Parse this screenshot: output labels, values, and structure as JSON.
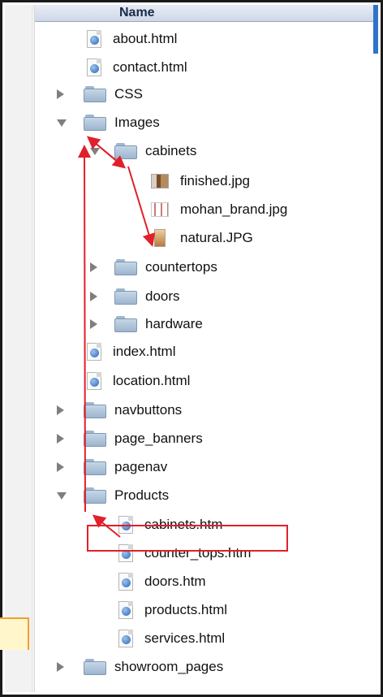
{
  "header": {
    "name_label": "Name"
  },
  "rows": [
    {
      "label": "about.html",
      "kind": "doc"
    },
    {
      "label": "contact.html",
      "kind": "doc"
    },
    {
      "label": "CSS",
      "kind": "folder",
      "state": "closed"
    },
    {
      "label": "Images",
      "kind": "folder",
      "state": "open"
    },
    {
      "label": "cabinets",
      "kind": "folder",
      "state": "open"
    },
    {
      "label": "finished.jpg",
      "kind": "image",
      "thumb": "finished"
    },
    {
      "label": "mohan_brand.jpg",
      "kind": "image",
      "thumb": "brand"
    },
    {
      "label": "natural.JPG",
      "kind": "image",
      "thumb": "natural"
    },
    {
      "label": "countertops",
      "kind": "folder",
      "state": "closed"
    },
    {
      "label": "doors",
      "kind": "folder",
      "state": "closed"
    },
    {
      "label": "hardware",
      "kind": "folder",
      "state": "closed"
    },
    {
      "label": "index.html",
      "kind": "doc"
    },
    {
      "label": "location.html",
      "kind": "doc"
    },
    {
      "label": "navbuttons",
      "kind": "folder",
      "state": "closed"
    },
    {
      "label": "page_banners",
      "kind": "folder",
      "state": "closed"
    },
    {
      "label": "pagenav",
      "kind": "folder",
      "state": "closed"
    },
    {
      "label": "Products",
      "kind": "folder",
      "state": "open"
    },
    {
      "label": "cabinets.htm",
      "kind": "doc"
    },
    {
      "label": "counter_tops.htm",
      "kind": "doc"
    },
    {
      "label": "doors.htm",
      "kind": "doc"
    },
    {
      "label": "products.html",
      "kind": "doc"
    },
    {
      "label": "services.html",
      "kind": "doc"
    },
    {
      "label": "showroom_pages",
      "kind": "folder",
      "state": "closed"
    }
  ],
  "colors": {
    "annotation_red": "#e0202a",
    "accent_blue": "#2f74c8"
  }
}
